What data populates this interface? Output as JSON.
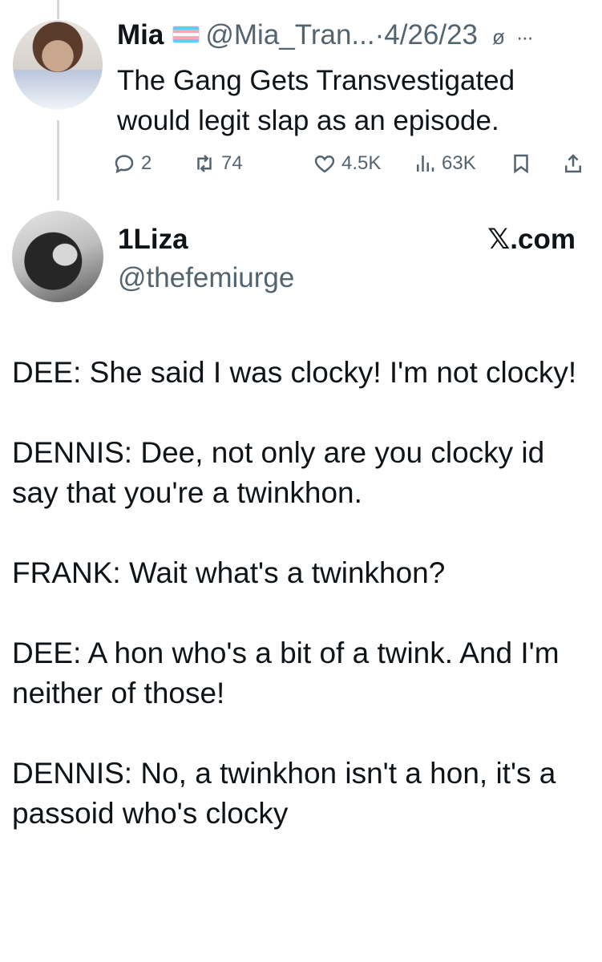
{
  "tweet1": {
    "name": "Mia",
    "flag_icon": "transgender-flag-icon",
    "handle": "@Mia_Tran...",
    "separator": "·",
    "date": "4/26/23",
    "muted_icon": "ø",
    "more_label": "···",
    "text_line1": "The Gang Gets Transvestigated",
    "text_line2": "would legit slap as an episode.",
    "actions": {
      "replies": "2",
      "reposts": "74",
      "likes": "4.5K",
      "views": "63K"
    }
  },
  "tweet2": {
    "name": "1Liza",
    "handle": "@thefemiurge",
    "source": "𝕏.com",
    "paragraphs": [
      "DEE: She said I was clocky! I'm not clocky!",
      "DENNIS: Dee, not only are you clocky id say that you're a twinkhon.",
      "FRANK: Wait what's a twinkhon?",
      "DEE: A hon who's a bit of a twink. And I'm neither of those!",
      "DENNIS: No, a twinkhon isn't a hon, it's a passoid who's clocky"
    ]
  },
  "colors": {
    "text": "#0f1419",
    "secondary": "#536471",
    "thread_line": "#cfd9de"
  }
}
